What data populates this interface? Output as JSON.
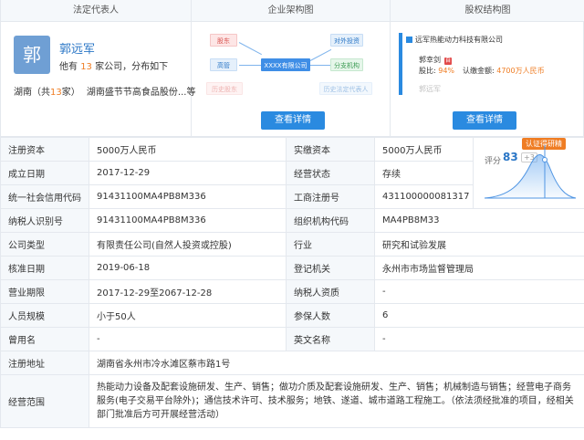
{
  "headers": {
    "legal_rep": "法定代表人",
    "org_chart": "企业架构图",
    "equity": "股权结构图"
  },
  "legal_rep": {
    "avatar_char": "郭",
    "name": "郭远军",
    "line_prefix": "他有",
    "company_count": "13",
    "line_suffix": "家公司，分布如下",
    "region_prefix": "湖南（共",
    "region_count": "13",
    "region_suffix": "家）",
    "region_company": "湖南盛节节高食品股份...等"
  },
  "org_chart": {
    "shareholder": "股东",
    "executive": "高管",
    "history_shareholder": "历史股东",
    "center": "XXXX有限公司",
    "foreign_investment": "对外投资",
    "branch": "分支机构",
    "history_legal_rep": "历史法定代表人",
    "button": "查看详情"
  },
  "equity": {
    "company": "远军热能动力科技有限公司",
    "holder": "郭幸剑",
    "holder_badge": "自",
    "ratio_label": "股比:",
    "ratio": "94%",
    "subscribed_label": "认缴金额:",
    "subscribed_amount": "4700万人民币",
    "next_holder": "郭远军",
    "button": "查看详情"
  },
  "score": {
    "tag": "认证得研精",
    "label": "评分",
    "value": "83",
    "delta": "+3"
  },
  "info": {
    "registered_capital_label": "注册资本",
    "registered_capital": "5000万人民币",
    "paid_capital_label": "实缴资本",
    "paid_capital": "5000万人民币",
    "established_label": "成立日期",
    "established": "2017-12-29",
    "status_label": "经营状态",
    "status": "存续",
    "credit_code_label": "统一社会信用代码",
    "credit_code": "91431100MA4PB8M336",
    "reg_no_label": "工商注册号",
    "reg_no": "431100000081317",
    "taxpayer_label": "纳税人识别号",
    "taxpayer": "91431100MA4PB8M336",
    "org_code_label": "组织机构代码",
    "org_code": "MA4PB8M33",
    "company_type_label": "公司类型",
    "company_type": "有限责任公司(自然人投资或控股)",
    "industry_label": "行业",
    "industry": "研究和试验发展",
    "approval_label": "核准日期",
    "approval": "2019-06-18",
    "authority_label": "登记机关",
    "authority": "永州市市场监督管理局",
    "term_label": "营业期限",
    "term": "2017-12-29至2067-12-28",
    "taxpayer_quality_label": "纳税人资质",
    "taxpayer_quality": "-",
    "staff_label": "人员规模",
    "staff": "小于50人",
    "insured_label": "参保人数",
    "insured": "6",
    "former_name_label": "曾用名",
    "former_name": "-",
    "english_name_label": "英文名称",
    "english_name": "-",
    "address_label": "注册地址",
    "address": "湖南省永州市冷水滩区蔡市路1号",
    "scope_label": "经营范围",
    "scope": "热能动力设备及配套设施研发、生产、销售；做功介质及配套设施研发、生产、销售；机械制造与销售；经营电子商务服务(电子交易平台除外)；通信技术许可、技术服务；地铁、遂道、城市道路工程施工。（依法须经批准的项目，经相关部门批准后方可开展经营活动）"
  }
}
